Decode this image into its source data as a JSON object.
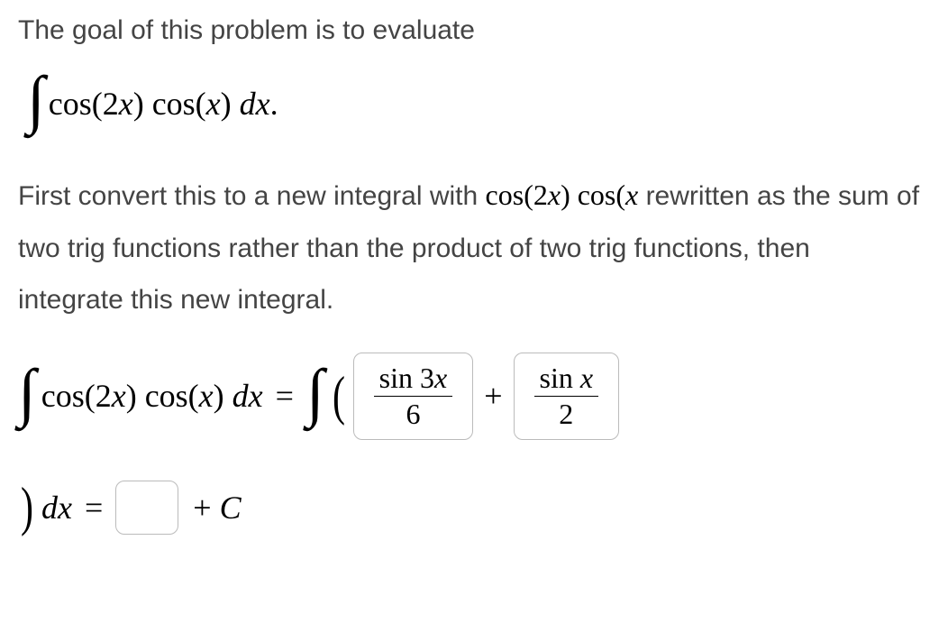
{
  "intro": "The goal of this problem is to evaluate",
  "integral_expr": {
    "integrand": "cos(2x) cos(x) dx",
    "period": "."
  },
  "paragraph": {
    "part1": "First convert this to a new integral with ",
    "inline_math": "cos(2x) cos(x",
    "part2": " rewritten as the sum of two trig functions rather than the product of two trig functions, then integrate this new integral."
  },
  "equation": {
    "lhs": "cos(2x) cos(x) dx",
    "eq": "=",
    "box1": {
      "num": "sin 3x",
      "den": "6"
    },
    "plus": "+",
    "box2": {
      "num": "sin x",
      "den": "2"
    },
    "dx": "dx",
    "eq2": "=",
    "plusC": "+ C"
  }
}
